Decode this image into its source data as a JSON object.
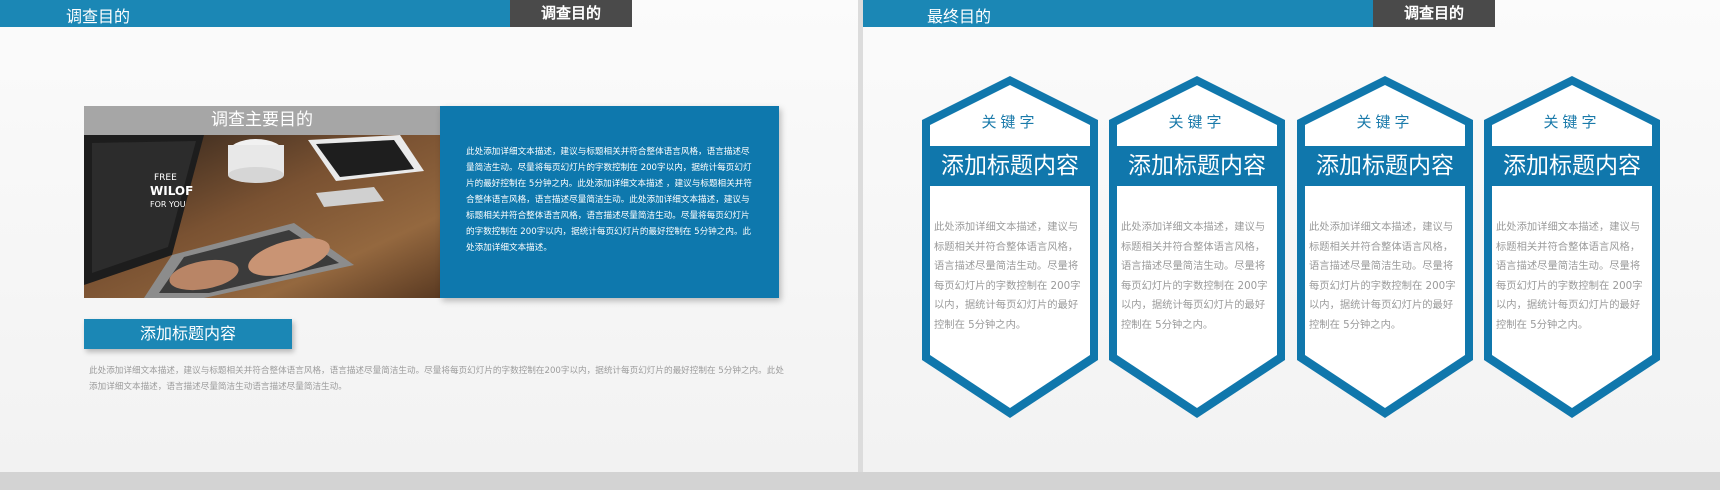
{
  "colors": {
    "accent": "#1b87b5",
    "panel": "#0e78ad",
    "dark_tab": "#4a4a4a",
    "gray_label": "#a6a6a6",
    "muted_text": "#9c9c9c"
  },
  "left_slide": {
    "header_title": "调查目的",
    "header_tab": "调查目的",
    "image_label": "调查主要目的",
    "photo_text": {
      "line1": "FREE",
      "line2": "WILOF",
      "line3": "FOR YOU"
    },
    "panel_text": "此处添加详细文本描述，建议与标题相关并符合整体语言风格，语言描述尽量简洁生动。尽量将每页幻灯片的字数控制在 200字以内，据统计每页幻灯片的最好控制在 5分钟之内。此处添加详细文本描述 ，建议与标题相关并符合整体语言风格，语言描述尽量简洁生动。此处添加详细文本描述，建议与标题相关并符合整体语言风格，语言描述尽量简洁生动。尽量将每页幻灯片的字数控制在 200字以内，据统计每页幻灯片的最好控制在 5分钟之内。此处添加详细文本描述。",
    "subtitle": "添加标题内容",
    "footnote": "此处添加详细文本描述，建议与标题相关并符合整体语言风格，语言描述尽量简洁生动。尽量将每页幻灯片的字数控制在200字以内，据统计每页幻灯片的最好控制在 5分钟之内。此处添加详细文本描述，语言描述尽量简洁生动语言描述尽量简洁生动。"
  },
  "right_slide": {
    "header_title": "最终目的",
    "header_tab": "调查目的",
    "cards": [
      {
        "keyword": "关键字",
        "title": "添加标题内容",
        "body": "此处添加详细文本描述，建议与标题相关并符合整体语言风格，语言描述尽量简洁生动。尽量将每页幻灯片的字数控制在 200字以内，据统计每页幻灯片的最好控制在 5分钟之内。"
      },
      {
        "keyword": "关键字",
        "title": "添加标题内容",
        "body": "此处添加详细文本描述，建议与标题相关并符合整体语言风格，语言描述尽量简洁生动。尽量将每页幻灯片的字数控制在 200字以内，据统计每页幻灯片的最好控制在 5分钟之内。"
      },
      {
        "keyword": "关键字",
        "title": "添加标题内容",
        "body": "此处添加详细文本描述，建议与标题相关并符合整体语言风格，语言描述尽量简洁生动。尽量将每页幻灯片的字数控制在 200字以内，据统计每页幻灯片的最好控制在 5分钟之内。"
      },
      {
        "keyword": "关键字",
        "title": "添加标题内容",
        "body": "此处添加详细文本描述，建议与标题相关并符合整体语言风格，语言描述尽量简洁生动。尽量将每页幻灯片的字数控制在 200字以内，据统计每页幻灯片的最好控制在 5分钟之内。"
      }
    ]
  }
}
